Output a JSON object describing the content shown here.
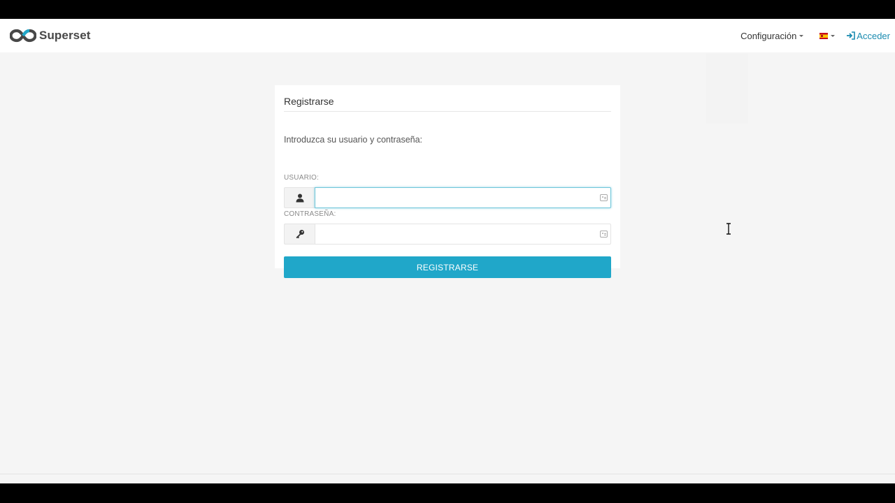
{
  "app": {
    "brand_name": "Superset",
    "brand_color": "#484848"
  },
  "navbar": {
    "settings_label": "Configuración",
    "language_flag": "es-flag-icon",
    "login_label": "Acceder",
    "login_color": "#1a8bb0"
  },
  "login_form": {
    "title": "Registrarse",
    "intro": "Introduzca su usuario y contraseña:",
    "username_label": "USUARIO:",
    "username_value": "",
    "password_label": "CONTRASEÑA:",
    "password_value": "",
    "submit_label": "REGISTRARSE",
    "submit_color": "#20a7c9"
  }
}
